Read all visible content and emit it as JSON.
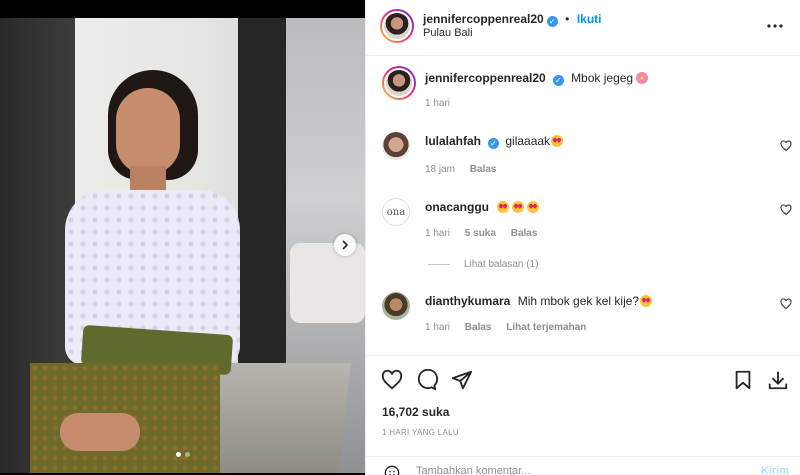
{
  "post": {
    "author": "jennifercoppenreal20",
    "follow_label": "Ikuti",
    "location": "Pulau Bali",
    "more_label": "•••",
    "caption": "Mbok jegeg",
    "caption_time": "1 hari",
    "carousel_dots": 2,
    "active_dot": 0
  },
  "comments": [
    {
      "username": "lulalahfah",
      "verified": true,
      "text": "gilaaaak",
      "emoji": "heart-eyes",
      "time": "18 jam",
      "likes": "",
      "reply_label": "Balas"
    },
    {
      "username": "onacanggu",
      "verified": false,
      "avatar_text": "ona",
      "text": "",
      "emoji": "heart-eyes x3",
      "time": "1 hari",
      "likes": "5 suka",
      "reply_label": "Balas",
      "view_replies": "Lihat balasan (1)"
    },
    {
      "username": "dianthykumara",
      "verified": false,
      "text": "Mih mbok gek kel kije?",
      "emoji": "heart-eyes",
      "time": "1 hari",
      "reply_label": "Balas",
      "translate_label": "Lihat terjemahan"
    }
  ],
  "stats": {
    "likes": "16,702 suka",
    "date": "1 HARI YANG LALU"
  },
  "composer": {
    "placeholder": "Tambahkan komentar...",
    "send_label": "Kirim"
  },
  "colors": {
    "accent": "#0095f6",
    "verified": "#3897f0",
    "muted": "#8e8e8e",
    "text": "#262626"
  },
  "icons": {
    "like": "heart-icon",
    "comment": "comment-icon",
    "share": "send-icon",
    "save": "bookmark-icon",
    "download": "download-icon",
    "next": "chevron-right-icon",
    "emoji": "emoji-icon"
  }
}
